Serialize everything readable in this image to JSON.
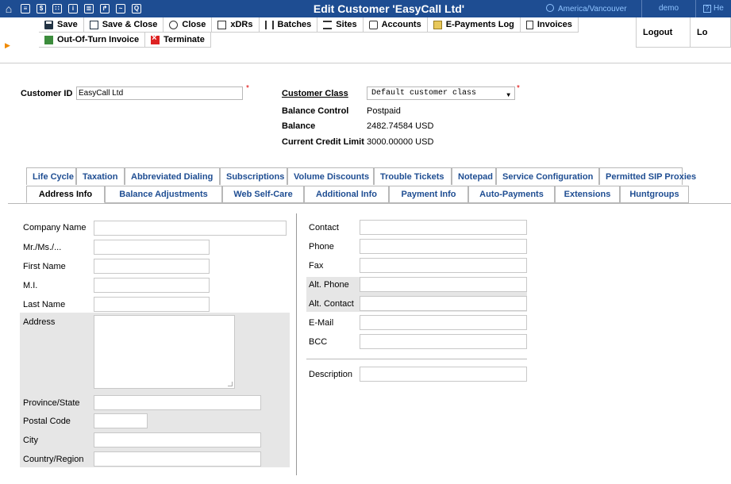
{
  "topbar": {
    "title": "Edit Customer 'EasyCall Ltd'",
    "timezone": "America/Vancouver",
    "user": "demo",
    "help": "He",
    "icons": [
      "home-icon",
      "list-icon",
      "dollar-icon",
      "grid-icon",
      "person-icon",
      "tabs-icon",
      "export-icon",
      "chart-icon",
      "search-icon"
    ]
  },
  "toolbar": {
    "save": "Save",
    "save_close": "Save & Close",
    "close": "Close",
    "xdrs": "xDRs",
    "batches": "Batches",
    "sites": "Sites",
    "accounts": "Accounts",
    "epayments": "E-Payments Log",
    "invoices": "Invoices",
    "out_of_turn": "Out-Of-Turn Invoice",
    "terminate": "Terminate",
    "logout": "Logout",
    "logout2": "Lo"
  },
  "customer": {
    "id_label": "Customer ID",
    "id_value": "EasyCall Ltd",
    "class_label": "Customer Class",
    "class_value": "Default customer class",
    "balance_control_label": "Balance Control",
    "balance_control_value": "Postpaid",
    "balance_label": "Balance",
    "balance_value": "2482.74584 USD",
    "credit_limit_label": "Current Credit Limit",
    "credit_limit_value": "3000.00000 USD"
  },
  "tabs_row1": [
    "Life Cycle",
    "Taxation",
    "Abbreviated Dialing",
    "Subscriptions",
    "Volume Discounts",
    "Trouble Tickets",
    "Notepad",
    "Service Configuration",
    "Permitted SIP Proxies"
  ],
  "tabs_row2": [
    "Address Info",
    "Balance Adjustments",
    "Web Self-Care",
    "Additional Info",
    "Payment Info",
    "Auto-Payments",
    "Extensions",
    "Huntgroups"
  ],
  "form": {
    "left": {
      "company_name": "Company Name",
      "mr_ms": "Mr./Ms./...",
      "first_name": "First Name",
      "mi": "M.I.",
      "last_name": "Last Name",
      "address": "Address",
      "province": "Province/State",
      "postal_code": "Postal Code",
      "city": "City",
      "country": "Country/Region"
    },
    "right": {
      "contact": "Contact",
      "phone": "Phone",
      "fax": "Fax",
      "alt_phone": "Alt. Phone",
      "alt_contact": "Alt. Contact",
      "email": "E-Mail",
      "bcc": "BCC",
      "description": "Description"
    }
  }
}
